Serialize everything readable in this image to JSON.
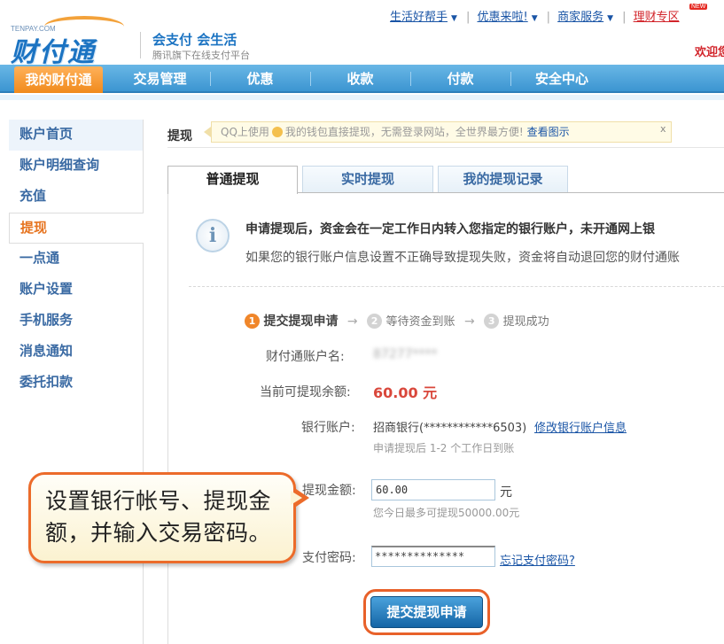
{
  "header": {
    "logo_small": "TENPAY.COM",
    "logo_text": "财付通",
    "slogan_title": "会支付 会生活",
    "slogan_sub": "腾讯旗下在线支付平台",
    "top_links": [
      {
        "label": "生活好帮手"
      },
      {
        "label": "优惠来啦!"
      },
      {
        "label": "商家服务"
      },
      {
        "label": "理财专区"
      }
    ],
    "new_badge": "NEW",
    "welcome": "欢迎您"
  },
  "nav": {
    "items": [
      "我的财付通",
      "交易管理",
      "优惠",
      "收款",
      "付款",
      "安全中心"
    ],
    "active_index": 0
  },
  "sidebar": {
    "items": [
      "账户首页",
      "账户明细查询",
      "充值",
      "提现",
      "一点通",
      "账户设置",
      "手机服务",
      "消息通知",
      "委托扣款"
    ],
    "active": "提现"
  },
  "page": {
    "title": "提现",
    "tip_prefix": "QQ上使用",
    "tip_text": "我的钱包直接提现，无需登录网站，全世界最方便!",
    "tip_link": "查看图示",
    "tip_close": "x"
  },
  "tabs": [
    "普通提现",
    "实时提现",
    "我的提现记录"
  ],
  "notice": {
    "line1": "申请提现后，资金会在一定工作日内转入您指定的银行账户，未开通网上银",
    "line2": "如果您的银行账户信息设置不正确导致提现失败，资金将自动退回您的财付通账"
  },
  "steps": [
    {
      "num": "1",
      "label": "提交提现申请"
    },
    {
      "num": "2",
      "label": "等待资金到账"
    },
    {
      "num": "3",
      "label": "提现成功"
    }
  ],
  "form": {
    "account_label": "财付通账户名:",
    "account_value": "87277****",
    "balance_label": "当前可提现余额:",
    "balance_value": "60.00 元",
    "bank_label": "银行账户:",
    "bank_value": "招商银行(************6503)",
    "bank_modify_link": "修改银行账户信息",
    "bank_hint": "申请提现后 1-2 个工作日到账",
    "amount_label": "提现金额:",
    "amount_value": "60.00",
    "amount_unit": "元",
    "amount_hint": "您今日最多可提现50000.00元",
    "password_label": "支付密码:",
    "password_value": "**************",
    "forgot_link": "忘记支付密码?",
    "submit_label": "提交提现申请"
  },
  "callout": {
    "line1": "设置银行帐号、提现金",
    "line2": "额，并输入交易密码。"
  }
}
